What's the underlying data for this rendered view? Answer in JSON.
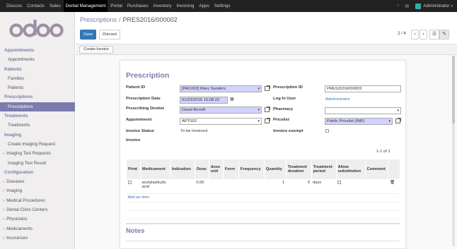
{
  "topbar": {
    "menu": [
      "Discuss",
      "Contacts",
      "Sales",
      "Dental Management",
      "Portal",
      "Purchases",
      "Inventory",
      "Invoicing",
      "Apps",
      "Settings"
    ],
    "active": "Dental Management",
    "user": "Administrator"
  },
  "sidebar": {
    "logo": "odoo",
    "sections": [
      {
        "title": "Appointments",
        "items": [
          {
            "label": "Appointments",
            "caret": false
          }
        ]
      },
      {
        "title": "Patients",
        "items": [
          {
            "label": "Families",
            "caret": false
          },
          {
            "label": "Patients",
            "caret": false
          }
        ]
      },
      {
        "title": "Prescriptions",
        "items": [
          {
            "label": "Prescriptions",
            "caret": false,
            "active": true
          }
        ]
      },
      {
        "title": "Treatments",
        "items": [
          {
            "label": "Treatments",
            "caret": false
          }
        ]
      },
      {
        "title": "Imaging",
        "items": [
          {
            "label": "Create Imaging Request",
            "caret": false
          },
          {
            "label": "Imaging Test Requests",
            "caret": true
          },
          {
            "label": "Imaging Test Result",
            "caret": false
          }
        ]
      },
      {
        "title": "Configuration",
        "items": [
          {
            "label": "Diseases",
            "caret": true
          },
          {
            "label": "Imaging",
            "caret": true
          },
          {
            "label": "Medical Procedures",
            "caret": true
          },
          {
            "label": "Dental Clinic Centers",
            "caret": true
          },
          {
            "label": "Physicians",
            "caret": true
          },
          {
            "label": "Medicaments",
            "caret": true
          },
          {
            "label": "Insurances",
            "caret": true
          }
        ]
      }
    ]
  },
  "breadcrumb": {
    "parent": "Prescriptions",
    "separator": "/",
    "current": "PRES2016/000002"
  },
  "buttons": {
    "save": "Save",
    "discard": "Discard",
    "create_invoice": "Create Invoice"
  },
  "pager": {
    "value": "2 / 4",
    "prev": "‹",
    "next": "›"
  },
  "form": {
    "title": "Prescription",
    "labels": {
      "patient_id": "Patient ID",
      "prescription_date": "Prescription Date",
      "prescribing_dentist": "Prescribing Dentist",
      "appointment": "Appointment",
      "invoice_status": "Invoice Status",
      "invoice": "Invoice",
      "prescription_id": "Prescription ID",
      "log_in_user": "Log In User",
      "pharmacy": "Pharmacy",
      "pricelist": "Pricelist",
      "invoice_exempt": "Invoice exempt"
    },
    "values": {
      "patient_id": "[PAC002] Mary Sanders",
      "prescription_date": "01/23/2016 15:08:22",
      "prescribing_dentist": "David Berioff",
      "appointment": "APT002",
      "invoice_status": "To be Invoiced",
      "prescription_id": "PRES2016/000002",
      "log_in_user": "Administrator",
      "pharmacy": "",
      "pricelist": "Public Pricelist (INR)"
    }
  },
  "lines": {
    "count": "1-1 of 1",
    "headers": [
      "Print",
      "Medicament",
      "Indication",
      "Dose",
      "dose unit",
      "Form",
      "Frequency",
      "Quantity",
      "Treatment duration",
      "Treatment period",
      "Allow substitution",
      "Comment"
    ],
    "rows": [
      {
        "medicament": "acetylsalicylic acid",
        "dose": "0.00",
        "quantity": "1",
        "duration": "0",
        "period": "days"
      }
    ],
    "add_item": "Add an item"
  },
  "notes_title": "Notes",
  "colors": {
    "brand": "#7c7bad",
    "primary": "#337ab7",
    "required": "#d2d2ff",
    "topbar": "#222222"
  }
}
